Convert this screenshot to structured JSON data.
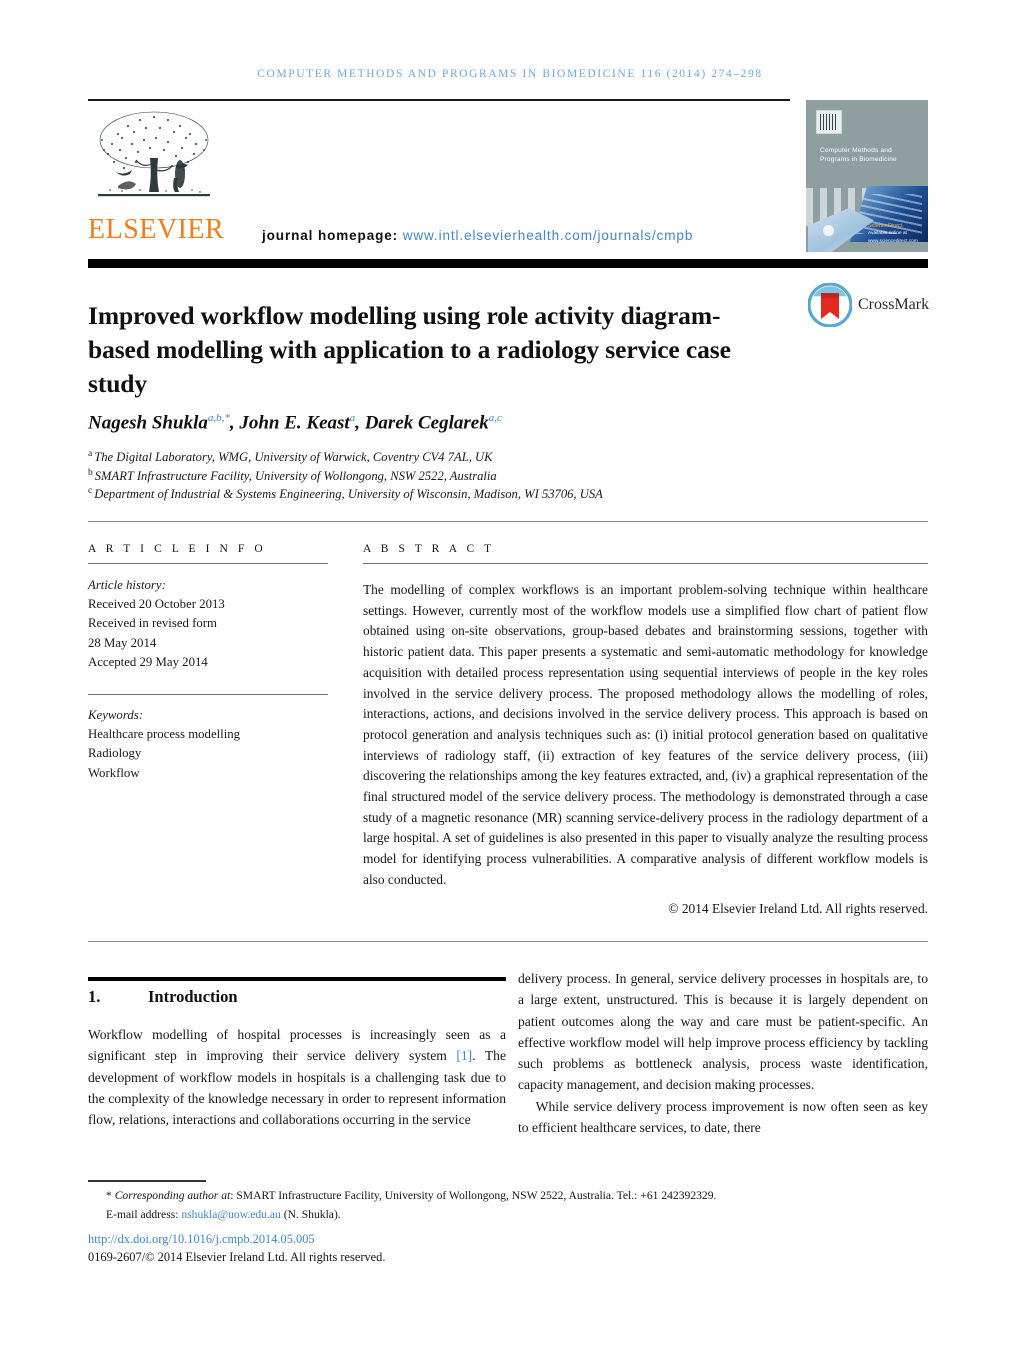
{
  "running_head": "Computer methods and programs in biomedicine 116 (2014) 274–298",
  "masthead": {
    "publisher_name": "ELSEVIER",
    "homepage_label": "journal homepage:",
    "homepage_url": "www.intl.elsevierhealth.com/journals/cmpb",
    "cover_title": "Computer Methods and Programs in Biomedicine",
    "cover_footer_big": "ScienceDirect",
    "cover_footer_small": "Available online at www.sciencedirect.com"
  },
  "crossmark": {
    "label": "CrossMark"
  },
  "article": {
    "title": "Improved workflow modelling using role activity diagram-based modelling with application to a radiology service case study",
    "authors_html": "Nagesh Shukla<sup>a,b,*</sup>, John E. Keast<sup>a</sup>, Darek Ceglarek<sup>a,c</sup>",
    "affiliations": [
      {
        "mark": "a",
        "text": "The Digital Laboratory, WMG, University of Warwick, Coventry CV4 7AL, UK"
      },
      {
        "mark": "b",
        "text": "SMART Infrastructure Facility, University of Wollongong, NSW 2522, Australia"
      },
      {
        "mark": "c",
        "text": "Department of Industrial & Systems Engineering, University of Wisconsin, Madison, WI 53706, USA"
      }
    ]
  },
  "info": {
    "heading": "A R T I C L E   I N F O",
    "history_label": "Article history:",
    "history": [
      "Received 20 October 2013",
      "Received in revised form",
      "28 May 2014",
      "Accepted 29 May 2014"
    ],
    "keywords_label": "Keywords:",
    "keywords": [
      "Healthcare process modelling",
      "Radiology",
      "Workflow"
    ]
  },
  "abstract": {
    "heading": "A B S T R A C T",
    "text": "The modelling of complex workflows is an important problem-solving technique within healthcare settings. However, currently most of the workflow models use a simplified flow chart of patient flow obtained using on-site observations, group-based debates and brainstorming sessions, together with historic patient data. This paper presents a systematic and semi-automatic methodology for knowledge acquisition with detailed process representation using sequential interviews of people in the key roles involved in the service delivery process. The proposed methodology allows the modelling of roles, interactions, actions, and decisions involved in the service delivery process. This approach is based on protocol generation and analysis techniques such as: (i) initial protocol generation based on qualitative interviews of radiology staff, (ii) extraction of key features of the service delivery process, (iii) discovering the relationships among the key features extracted, and, (iv) a graphical representation of the final structured model of the service delivery process. The methodology is demonstrated through a case study of a magnetic resonance (MR) scanning service-delivery process in the radiology department of a large hospital. A set of guidelines is also presented in this paper to visually analyze the resulting process model for identifying process vulnerabilities. A comparative analysis of different workflow models is also conducted.",
    "copyright": "© 2014 Elsevier Ireland Ltd. All rights reserved."
  },
  "section": {
    "number": "1.",
    "title": "Introduction"
  },
  "body": {
    "left_pre": "Workflow modelling of hospital processes is increasingly seen as a significant step in improving their service delivery system ",
    "left_cite": "[1]",
    "left_post": ". The development of workflow models in hospitals is a challenging task due to the complexity of the knowledge necessary in order to represent information flow, relations, interactions and collaborations occurring in the service",
    "right_p1": "delivery process. In general, service delivery processes in hospitals are, to a large extent, unstructured. This is because it is largely dependent on patient outcomes along the way and care must be patient-specific. An effective workflow model will help improve process efficiency by tackling such problems as bottleneck analysis, process waste identification, capacity management, and decision making processes.",
    "right_p2": "While service delivery process improvement is now often seen as key to efficient healthcare services, to date, there"
  },
  "footer": {
    "corresponding_star": "*",
    "corresponding_label": "Corresponding author at",
    "corresponding_text": ": SMART Infrastructure Facility, University of Wollongong, NSW 2522, Australia. Tel.: +61 242392329.",
    "email_label": "E-mail address:",
    "email": "nshukla@uow.edu.au",
    "email_owner": "(N. Shukla).",
    "doi": "http://dx.doi.org/10.1016/j.cmpb.2014.05.005",
    "issn_line": "0169-2607/© 2014 Elsevier Ireland Ltd. All rights reserved."
  },
  "colors": {
    "link_blue": "#3f87c8",
    "running_head_blue": "#6aa9dd",
    "elsevier_orange": "#f07d1a",
    "cover_bg": "#8f9e9e"
  }
}
